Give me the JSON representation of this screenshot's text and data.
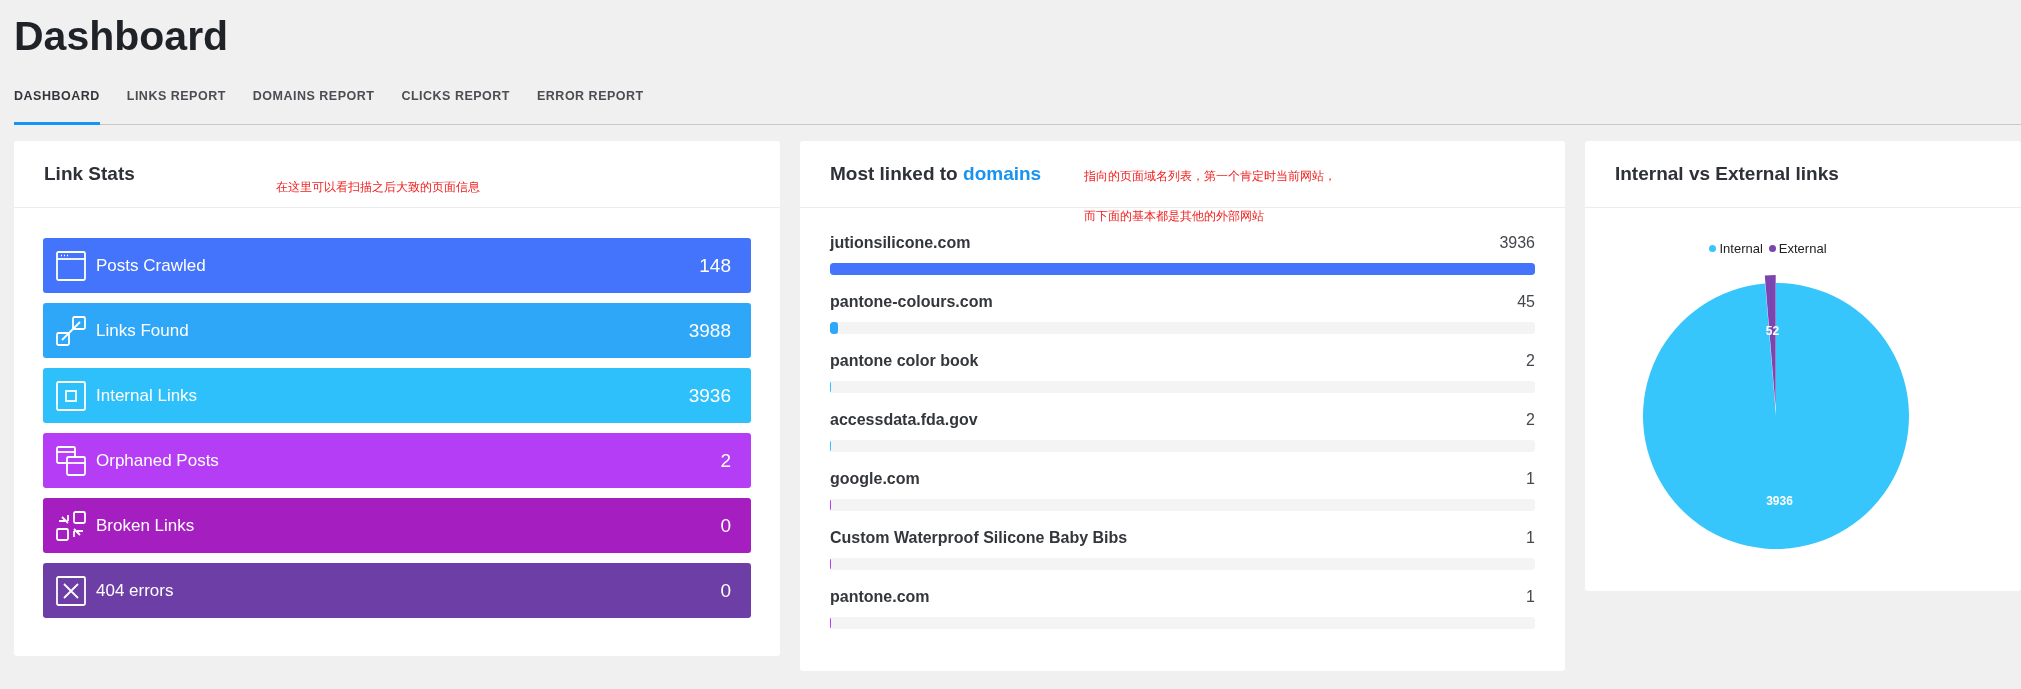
{
  "page_title": "Dashboard",
  "tabs": [
    {
      "label": "DASHBOARD",
      "selected": true
    },
    {
      "label": "LINKS REPORT",
      "selected": false
    },
    {
      "label": "DOMAINS REPORT",
      "selected": false
    },
    {
      "label": "CLICKS REPORT",
      "selected": false
    },
    {
      "label": "ERROR REPORT",
      "selected": false
    }
  ],
  "link_stats": {
    "title": "Link Stats",
    "note": "在这里可以看扫描之后大致的页面信息",
    "rows": [
      {
        "kind": "window",
        "label": "Posts Crawled",
        "value": "148",
        "color": "#4374fb"
      },
      {
        "kind": "link",
        "label": "Links Found",
        "value": "3988",
        "color": "#2ea7f8"
      },
      {
        "kind": "square",
        "label": "Internal Links",
        "value": "3936",
        "color": "#2ec0fb"
      },
      {
        "kind": "windows",
        "label": "Orphaned Posts",
        "value": "2",
        "color": "#b63df6"
      },
      {
        "kind": "broken",
        "label": "Broken Links",
        "value": "0",
        "color": "#a51ec0"
      },
      {
        "kind": "cross",
        "label": "404 errors",
        "value": "0",
        "color": "#6c3ea6"
      }
    ]
  },
  "domains": {
    "title": "Most linked to ",
    "title_link": "domains",
    "notes": [
      "指向的页面域名列表，第一个肯定时当前网站，",
      "而下面的基本都是其他的外部网站"
    ],
    "items": [
      {
        "name": "jutionsilicone.com",
        "count": "3936",
        "level": 1,
        "color": "#4374fb"
      },
      {
        "name": "pantone-colours.com",
        "count": "45",
        "level": 0.011,
        "color": "#2ea7f8"
      },
      {
        "name": "pantone color book",
        "count": "2",
        "level": 0.001,
        "color": "#2ec0fb"
      },
      {
        "name": "accessdata.fda.gov",
        "count": "2",
        "level": 0.001,
        "color": "#2ec0fb"
      },
      {
        "name": "google.com",
        "count": "1",
        "level": 0.0005,
        "color": "#b63df6"
      },
      {
        "name": "Custom Waterproof Silicone Baby Bibs",
        "count": "1",
        "level": 0.0005,
        "color": "#b63df6"
      },
      {
        "name": "pantone.com",
        "count": "1",
        "level": 0.0005,
        "color": "#b63df6"
      }
    ]
  },
  "internal_vs_external": {
    "title": "Internal vs External links",
    "chart_data": {
      "type": "pie",
      "categories": [
        "Internal",
        "External"
      ],
      "values": [
        3936,
        52
      ],
      "colors": [
        "#36c6fb",
        "#7a45b0"
      ],
      "legend": "top",
      "data_labels": true
    }
  }
}
